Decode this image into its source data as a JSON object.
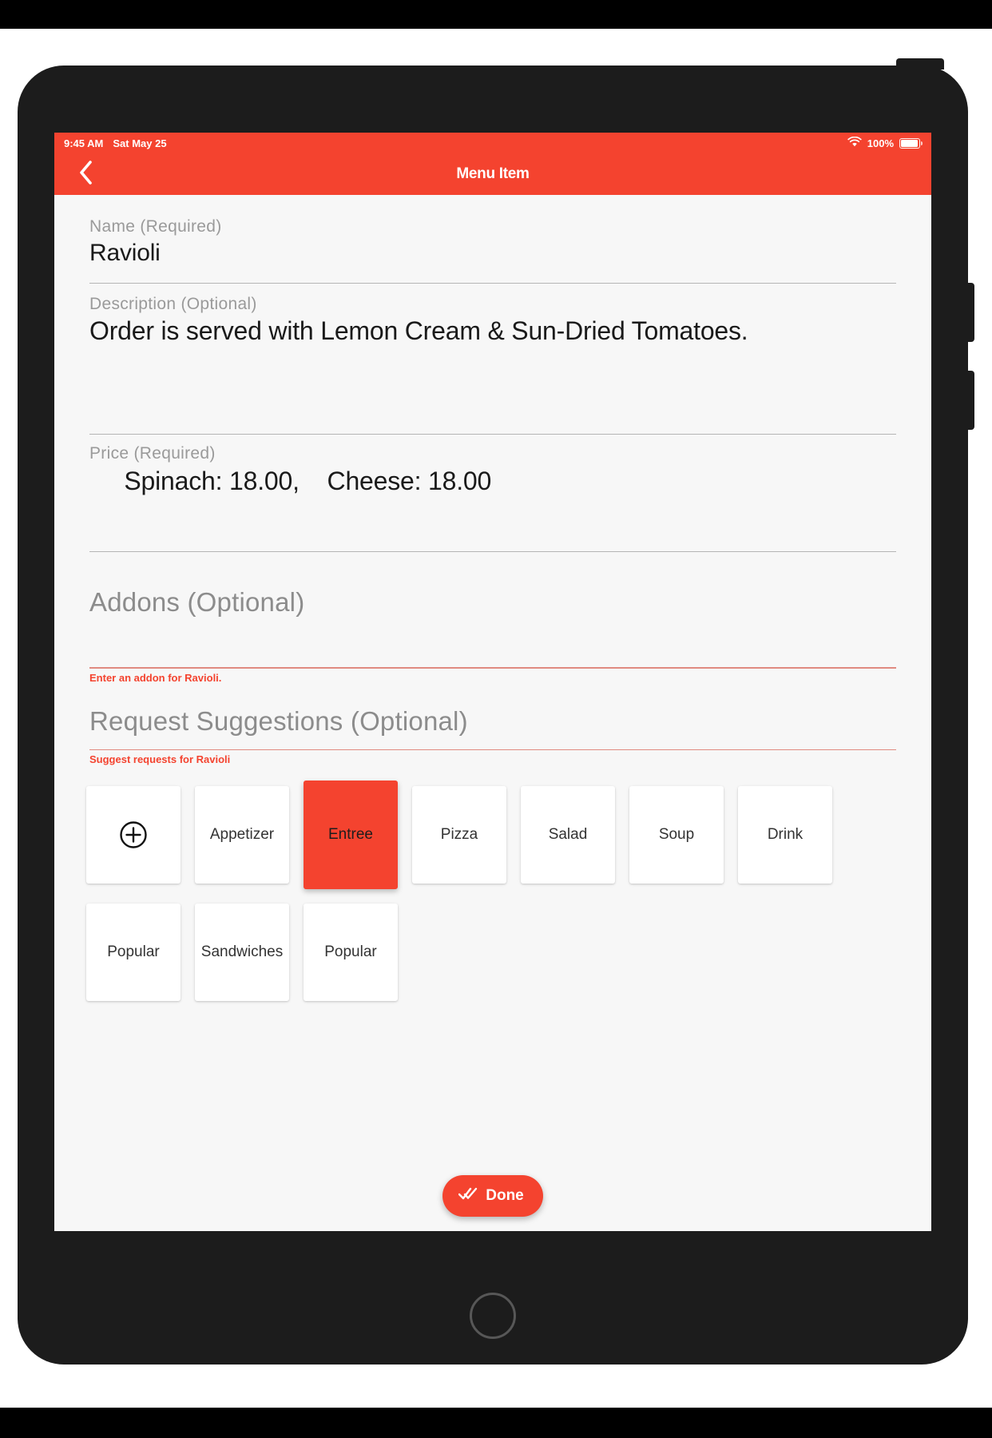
{
  "statusbar": {
    "time": "9:45 AM",
    "date": "Sat May 25",
    "wifi_icon": "wifi-icon",
    "battery_percent": "100%",
    "battery_icon": "battery-full-icon"
  },
  "navbar": {
    "back_icon": "chevron-left-icon",
    "title": "Menu Item"
  },
  "form": {
    "name": {
      "label": "Name (Required)",
      "value": "Ravioli"
    },
    "description": {
      "label": "Description (Optional)",
      "value": "Order is served with Lemon Cream & Sun-Dried Tomatoes."
    },
    "price": {
      "label": "Price (Required)",
      "value": "  Spinach: 18.00,    Cheese: 18.00"
    },
    "addons": {
      "placeholder": "Addons (Optional)",
      "helper": "Enter an addon for Ravioli."
    },
    "requests": {
      "placeholder": "Request Suggestions (Optional)",
      "helper": "Suggest requests for Ravioli"
    }
  },
  "chips": [
    {
      "label": "",
      "icon": "plus-circle-icon",
      "selected": false,
      "is_add": true
    },
    {
      "label": "Appetizer",
      "selected": false,
      "is_add": false
    },
    {
      "label": "Entree",
      "selected": true,
      "is_add": false
    },
    {
      "label": "Pizza",
      "selected": false,
      "is_add": false
    },
    {
      "label": "Salad",
      "selected": false,
      "is_add": false
    },
    {
      "label": "Soup",
      "selected": false,
      "is_add": false
    },
    {
      "label": "Drink",
      "selected": false,
      "is_add": false
    },
    {
      "label": "Popular",
      "selected": false,
      "is_add": false
    },
    {
      "label": "Sandwiches",
      "selected": false,
      "is_add": false
    },
    {
      "label": "Popular",
      "selected": false,
      "is_add": false
    }
  ],
  "done": {
    "label": "Done",
    "icon": "double-check-icon"
  },
  "colors": {
    "accent": "#F4432F",
    "screen_bg": "#f7f7f7",
    "bezel": "#1c1c1c",
    "helper_red": "#F4432F",
    "rule_red": "#e08a80",
    "label_gray": "#9a9a9a"
  }
}
